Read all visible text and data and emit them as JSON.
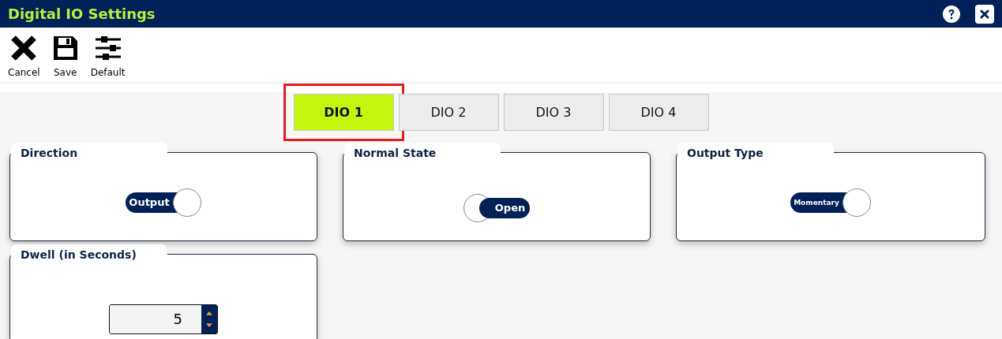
{
  "window": {
    "title": "Digital IO Settings"
  },
  "toolbar": [
    {
      "kind": "cancel",
      "label": "Cancel"
    },
    {
      "kind": "save",
      "label": "Save"
    },
    {
      "kind": "default",
      "label": "Default"
    }
  ],
  "tabs": [
    {
      "label": "DIO 1",
      "selected": true
    },
    {
      "label": "DIO 2",
      "selected": false
    },
    {
      "label": "DIO 3",
      "selected": false
    },
    {
      "label": "DIO 4",
      "selected": false
    }
  ],
  "panels": [
    {
      "kind": "toggle",
      "title": "Direction",
      "label": "Output",
      "on": true
    },
    {
      "kind": "toggle",
      "title": "Normal State",
      "label": "Open",
      "on": false
    },
    {
      "kind": "toggle",
      "title": "Output Type",
      "label": "Momentary",
      "on": true
    },
    {
      "kind": "number",
      "title": "Dwell (in Seconds)",
      "value": "5"
    }
  ]
}
